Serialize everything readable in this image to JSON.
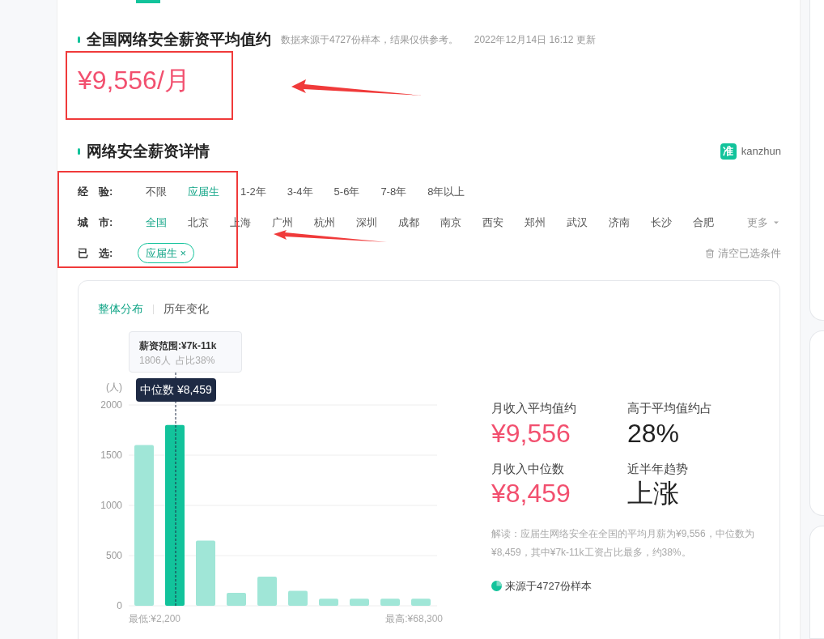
{
  "summary": {
    "title": "全国网络安全薪资平均值约",
    "note": "数据来源于4727份样本，结果仅供参考。",
    "updated": "2022年12月14日 16:12 更新",
    "average": "¥9,556/月"
  },
  "details": {
    "title": "网络安全薪资详情",
    "brand_mark": "准",
    "brand_name": "kanzhun",
    "filters": [
      {
        "label": "经　验:",
        "options": [
          {
            "label": "不限",
            "selected": false
          },
          {
            "label": "应届生",
            "selected": true
          },
          {
            "label": "1-2年",
            "selected": false
          },
          {
            "label": "3-4年",
            "selected": false
          },
          {
            "label": "5-6年",
            "selected": false
          },
          {
            "label": "7-8年",
            "selected": false
          },
          {
            "label": "8年以上",
            "selected": false
          }
        ]
      },
      {
        "label": "城　市:",
        "options": [
          {
            "label": "全国",
            "selected": true
          },
          {
            "label": "北京",
            "selected": false
          },
          {
            "label": "上海",
            "selected": false
          },
          {
            "label": "广州",
            "selected": false
          },
          {
            "label": "杭州",
            "selected": false
          },
          {
            "label": "深圳",
            "selected": false
          },
          {
            "label": "成都",
            "selected": false
          },
          {
            "label": "南京",
            "selected": false
          },
          {
            "label": "西安",
            "selected": false
          },
          {
            "label": "郑州",
            "selected": false
          },
          {
            "label": "武汉",
            "selected": false
          },
          {
            "label": "济南",
            "selected": false
          },
          {
            "label": "长沙",
            "selected": false
          },
          {
            "label": "合肥",
            "selected": false
          }
        ],
        "more": "更多"
      }
    ],
    "chosen": {
      "label": "已　选:",
      "tags": [
        "应届生 ×"
      ],
      "clear": "清空已选条件"
    }
  },
  "panel": {
    "tabs": [
      {
        "label": "整体分布",
        "selected": true
      },
      {
        "label": "历年变化",
        "selected": false
      }
    ],
    "chart": {
      "tooltip_title": "薪资范围:¥7k-11k",
      "tooltip_detail": "1806人  占比38%",
      "median_label": "中位数 ¥8,459",
      "min_label": "最低:¥2,200",
      "max_label": "最高:¥68,300",
      "bar_states": [
        {
          "selected": false
        },
        {
          "selected": true
        },
        {
          "selected": false
        },
        {
          "selected": false
        },
        {
          "selected": false
        },
        {
          "selected": false
        },
        {
          "selected": false
        },
        {
          "selected": false
        },
        {
          "selected": false
        },
        {
          "selected": false
        }
      ],
      "chart_data": {
        "type": "bar",
        "grid": true,
        "ylabel": "(人)",
        "values": [
          1600,
          1800,
          650,
          130,
          290,
          150,
          70,
          70,
          70,
          70
        ],
        "ylim": [
          0,
          2000
        ],
        "yticks": [
          0,
          500,
          1000,
          1500,
          2000
        ]
      }
    },
    "stats": [
      {
        "label": "月收入平均值约",
        "value": "¥9,556",
        "kind": "money"
      },
      {
        "label": "高于平均值约占",
        "value": "28%",
        "kind": "plain"
      },
      {
        "label": "月收入中位数",
        "value": "¥8,459",
        "kind": "money"
      },
      {
        "label": "近半年趋势",
        "value": "上涨",
        "kind": "plain"
      }
    ],
    "reading": "解读：应届生网络安全在全国的平均月薪为¥9,556，中位数为¥8,459，其中¥7k-11k工资占比最多，约38%。",
    "source": "来源于4727份样本"
  }
}
